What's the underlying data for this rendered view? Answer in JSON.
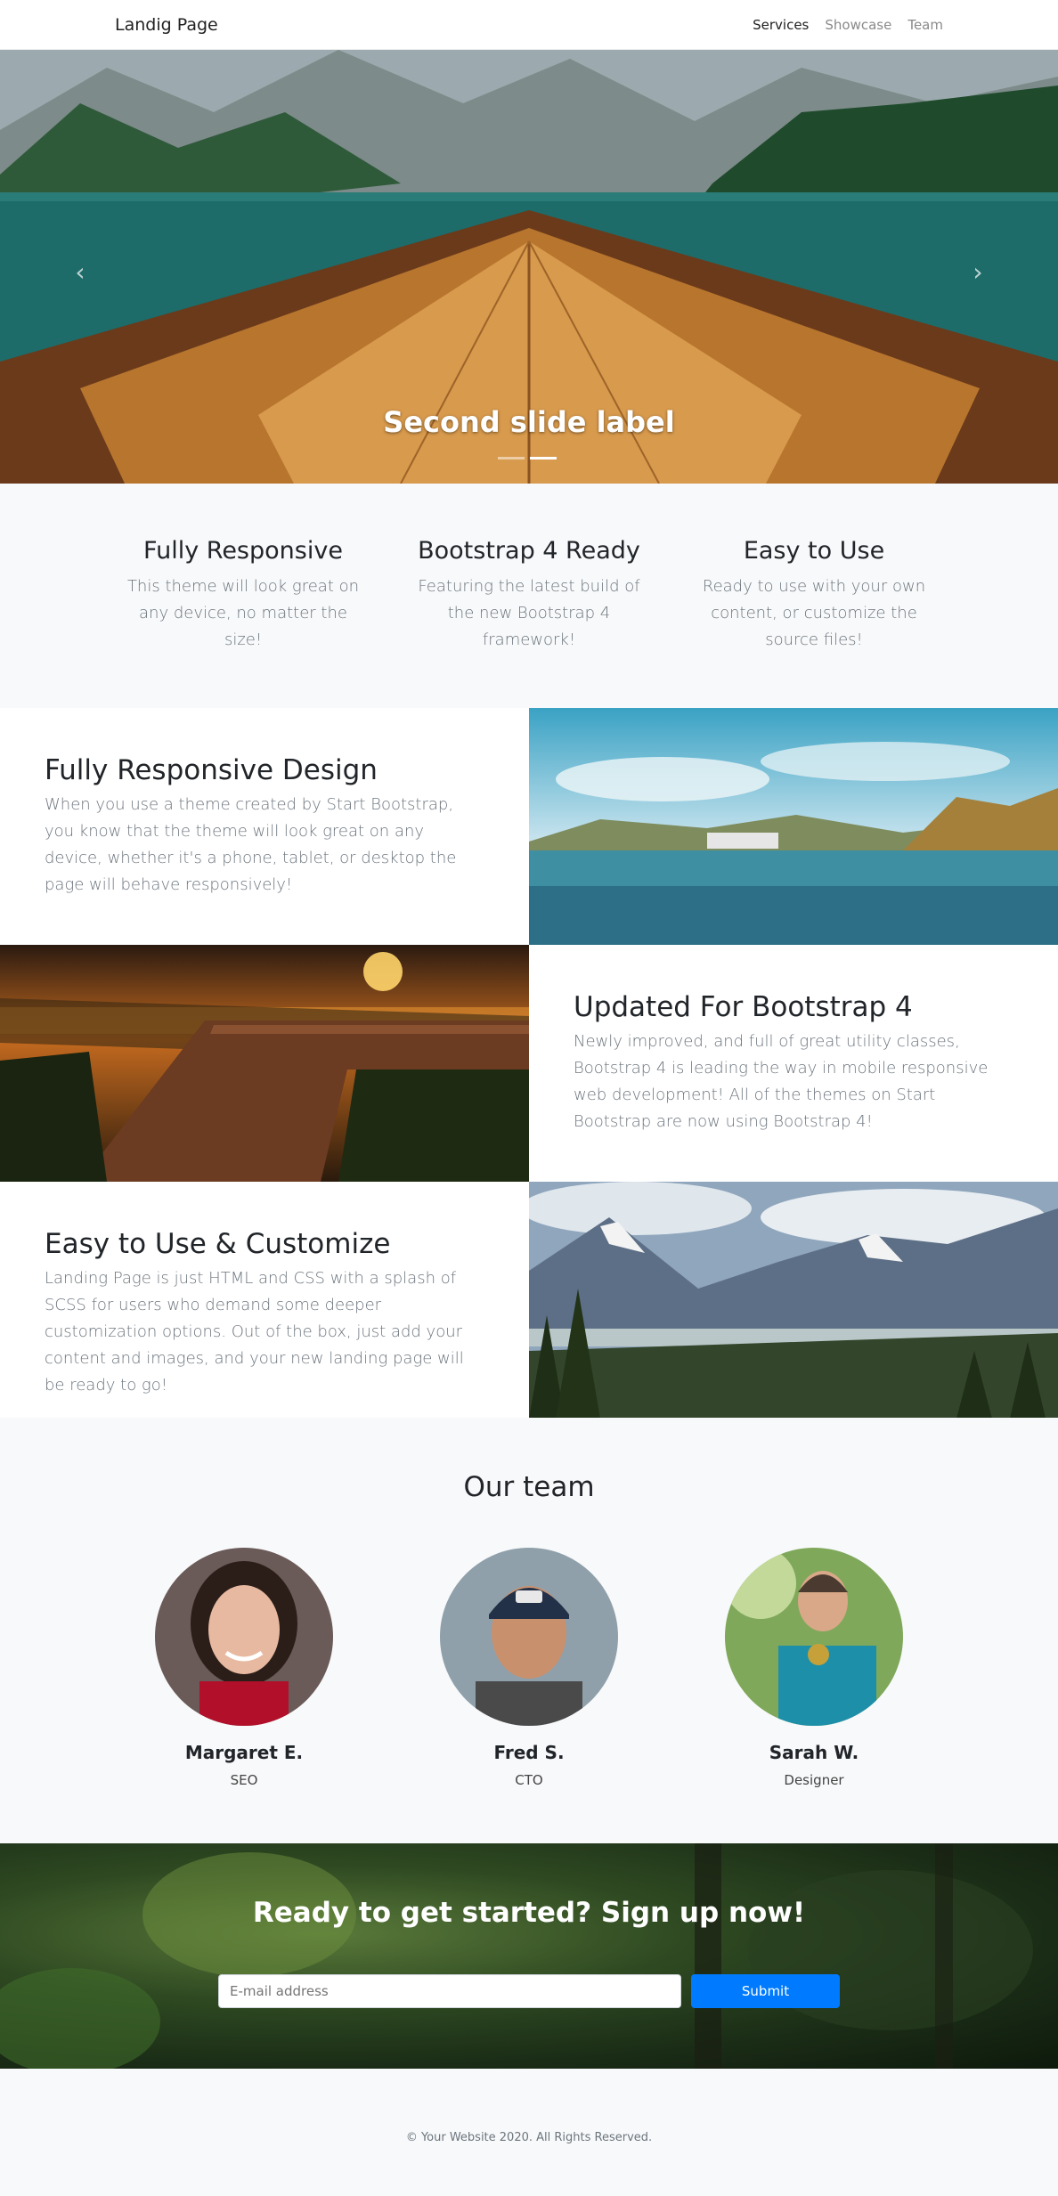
{
  "navbar": {
    "brand": "Landig Page",
    "links": [
      {
        "label": "Services",
        "active": true
      },
      {
        "label": "Showcase",
        "active": false
      },
      {
        "label": "Team",
        "active": false
      }
    ]
  },
  "hero": {
    "caption": "Second slide label",
    "indicators": [
      {
        "active": false
      },
      {
        "active": true
      }
    ],
    "prev_icon": "chevron-left-icon",
    "next_icon": "chevron-right-icon"
  },
  "features": [
    {
      "title": "Fully Responsive",
      "text": "This theme will look great on any device, no matter the size!"
    },
    {
      "title": "Bootstrap 4 Ready",
      "text": "Featuring the latest build of the new Bootstrap 4 framework!"
    },
    {
      "title": "Easy to Use",
      "text": "Ready to use with your own content, or customize the source files!"
    }
  ],
  "showcase": [
    {
      "title": "Fully Responsive Design",
      "text": "When you use a theme created by Start Bootstrap, you know that the theme will look great on any device, whether it's a phone, tablet, or desktop the page will behave responsively!"
    },
    {
      "title": "Updated For Bootstrap 4",
      "text": "Newly improved, and full of great utility classes, Bootstrap 4 is leading the way in mobile responsive web development! All of the themes on Start Bootstrap are now using Bootstrap 4!"
    },
    {
      "title": "Easy to Use & Customize",
      "text": "Landing Page is just HTML and CSS with a splash of SCSS for users who demand some deeper customization options. Out of the box, just add your content and images, and your new landing page will be ready to go!"
    }
  ],
  "team": {
    "title": "Our team",
    "members": [
      {
        "name": "Margaret E.",
        "role": "SEO"
      },
      {
        "name": "Fred S.",
        "role": "CTO"
      },
      {
        "name": "Sarah W.",
        "role": "Designer"
      }
    ]
  },
  "cta": {
    "title": "Ready to get started? Sign up now!",
    "input_placeholder": "E-mail address",
    "button_label": "Submit"
  },
  "footer": {
    "copyright": "© Your Website 2020. All Rights Reserved."
  },
  "colors": {
    "primary": "#007bff",
    "light_bg": "#f8f9fa",
    "muted_text": "#6c757d"
  }
}
